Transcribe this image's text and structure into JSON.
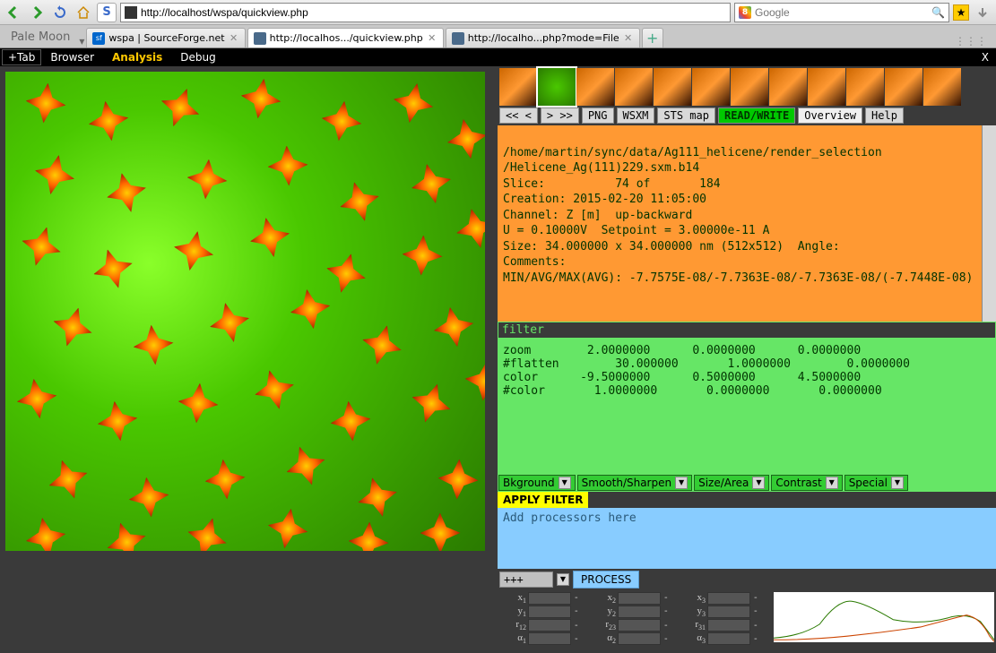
{
  "browser": {
    "url": "http://localhost/wspa/quickview.php",
    "search_placeholder": "Google",
    "palemoon": "Pale Moon",
    "tabs": [
      {
        "label": "wspa | SourceForge.net"
      },
      {
        "label": "http://localhos.../quickview.php"
      },
      {
        "label": "http://localho...php?mode=File"
      }
    ]
  },
  "menubar": {
    "plus_tab": "+Tab",
    "items": [
      "Browser",
      "Analysis",
      "Debug"
    ],
    "active_index": 1
  },
  "nav_buttons": {
    "back2": "<< <",
    "fwd2": "> >>",
    "png": "PNG",
    "wsxm": "WSXM",
    "sts": "STS map",
    "rw": "READ/WRITE",
    "overview": "Overview",
    "help": "Help"
  },
  "info": {
    "path": "/home/martin/sync/data/Ag111_helicene/render_selection",
    "file": "/Helicene_Ag(111)229.sxm.b14",
    "slice": "Slice:          74 of       184",
    "creation": "Creation: 2015-02-20 11:05:00",
    "channel": "Channel: Z [m]  up-backward",
    "params": "U = 0.10000V  Setpoint = 3.00000e-11 A",
    "size": "Size: 34.000000 x 34.000000 nm (512x512)  Angle:",
    "comments": "Comments:",
    "minmax": "MIN/AVG/MAX(AVG): -7.7575E-08/-7.7363E-08/-7.7363E-08/(-7.7448E-08)"
  },
  "filter": {
    "label": "filter",
    "rows": "zoom        2.0000000      0.0000000      0.0000000\n#flatten        30.000000       1.0000000        0.0000000\ncolor      -9.5000000      0.5000000      4.5000000\n#color       1.0000000       0.0000000       0.0000000"
  },
  "dropdowns": [
    "Bkground",
    "Smooth/Sharpen",
    "Size/Area",
    "Contrast",
    "Special"
  ],
  "apply": "APPLY FILTER",
  "proc_placeholder": "Add processors here",
  "plus": "+++",
  "process": "PROCESS",
  "param_grid": {
    "cols": [
      [
        "x₁",
        "y₁",
        "r₁₂",
        "α₁"
      ],
      [
        "x₂",
        "y₂",
        "r₂₃",
        "α₂"
      ],
      [
        "x₃",
        "y₃",
        "r₃₁",
        "α₃"
      ]
    ]
  }
}
